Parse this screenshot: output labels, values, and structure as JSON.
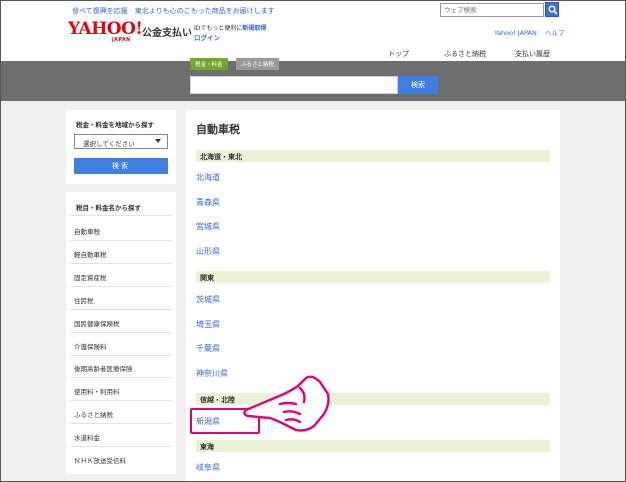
{
  "topbar": {
    "promo": "食べて復興を応援　東北よりも心のこもった商品をお届けします",
    "search_placeholder": "ウェブ検索",
    "search_icon": "search-icon"
  },
  "header": {
    "logo_word": "YAHOO!",
    "logo_sub": "JAPAN",
    "service_name": "公金支払い",
    "login_note_prefix": "IDでもっと便利に",
    "login_note_new": "新規取得",
    "login_link": "ログイン",
    "link_yahoo": "Yahoo! JAPAN",
    "link_help": "ヘルプ"
  },
  "nav": {
    "items": [
      "トップ",
      "ふるさと納税",
      "支払い履歴"
    ]
  },
  "search": {
    "tabs": [
      "税金・料金",
      "ふるさと納税"
    ],
    "button": "検索"
  },
  "sidebar": {
    "region_title": "税金・料金を地域から探す",
    "select_value": "選択してください",
    "search_button": "検索",
    "names_title": "税目・料金名から探す",
    "items": [
      "自動車税",
      "軽自動車税",
      "固定資産税",
      "住民税",
      "国民健康保険税",
      "介護保険料",
      "後期高齢者医療保険",
      "使用料・利用料",
      "ふるさと納税",
      "水道料金",
      "ＮＨＫ放送受信料"
    ]
  },
  "main": {
    "title": "自動車税",
    "regions": [
      {
        "name": "北海道・東北",
        "prefectures": [
          "北海道",
          "青森県",
          "宮城県",
          "山形県"
        ]
      },
      {
        "name": "関東",
        "prefectures": [
          "茨城県",
          "埼玉県",
          "千葉県",
          "神奈川県"
        ]
      },
      {
        "name": "信越・北陸",
        "prefectures": [
          "新潟県"
        ]
      },
      {
        "name": "東海",
        "prefectures": [
          "岐阜県"
        ]
      }
    ]
  },
  "colors": {
    "brand_red": "#e60012",
    "link_blue": "#3366cc",
    "button_blue": "#3f7fdd",
    "region_bar": "#eaf2d6",
    "highlight_pink": "#e0007a"
  }
}
